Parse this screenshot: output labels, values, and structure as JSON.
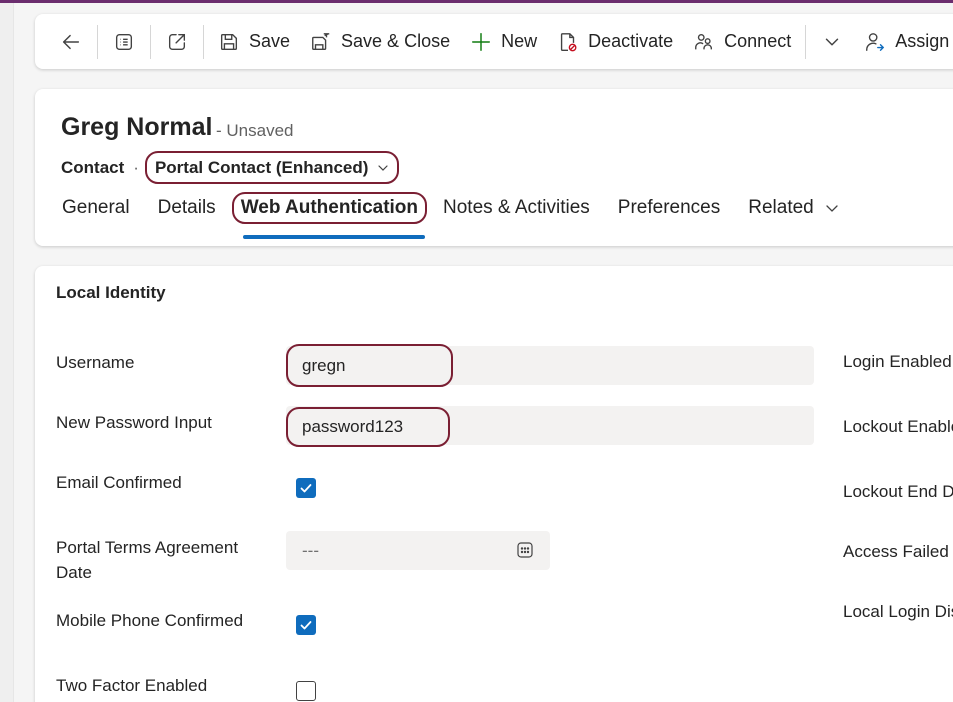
{
  "colors": {
    "accent_bar": "#6b2d6e",
    "highlight_border": "#7a1f33",
    "tab_underline": "#0f6cbd",
    "checkbox_on": "#0f6cbd"
  },
  "toolbar": {
    "back_icon": "arrow-left-icon",
    "list_icon": "record-list-icon",
    "popout_icon": "open-new-window-icon",
    "save": "Save",
    "save_close": "Save & Close",
    "new": "New",
    "deactivate": "Deactivate",
    "connect": "Connect",
    "more_icon": "chevron-down-icon",
    "assign": "Assign"
  },
  "header": {
    "title": "Greg Normal",
    "status": "- Unsaved",
    "entity": "Contact",
    "dot": "·",
    "form_name": "Portal Contact (Enhanced)"
  },
  "tabs": {
    "general": "General",
    "details": "Details",
    "web_auth": "Web Authentication",
    "notes": "Notes & Activities",
    "preferences": "Preferences",
    "related": "Related"
  },
  "section": {
    "title": "Local Identity",
    "fields": {
      "username_label": "Username",
      "username_value": "gregn",
      "password_label": "New Password Input",
      "password_value": "password123",
      "email_confirmed_label": "Email Confirmed",
      "email_confirmed": true,
      "terms_label": "Portal Terms Agreement Date",
      "terms_value": "---",
      "mobile_confirmed_label": "Mobile Phone Confirmed",
      "mobile_confirmed": true,
      "two_factor_label": "Two Factor Enabled",
      "two_factor": false
    },
    "right_labels": {
      "login_enabled": "Login Enabled",
      "lockout_enabled": "Lockout Enable",
      "lockout_end": "Lockout End D",
      "access_failed": "Access Failed (",
      "local_login": "Local Login Dis"
    }
  }
}
